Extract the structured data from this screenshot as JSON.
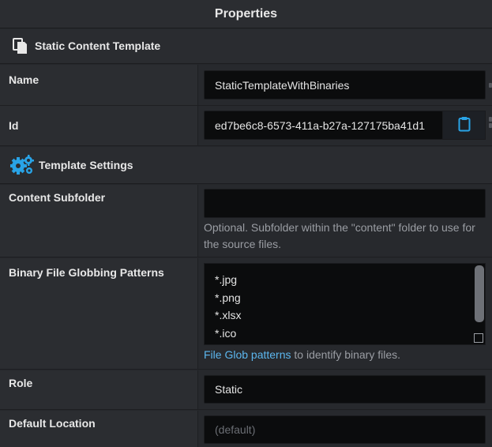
{
  "panel_title": "Properties",
  "sections": {
    "static": {
      "title": "Static Content Template",
      "icon": "copy-document-icon"
    },
    "settings": {
      "title": "Template Settings",
      "icon": "gears-icon"
    }
  },
  "fields": {
    "name": {
      "label": "Name",
      "value": "StaticTemplateWithBinaries"
    },
    "id": {
      "label": "Id",
      "value": "ed7be6c8-6573-411a-b27a-127175ba41d1",
      "action_icon": "clipboard-icon"
    },
    "content_subfolder": {
      "label": "Content Subfolder",
      "value": "",
      "help_line1": "Optional. Subfolder within the \"content\" folder to use for",
      "help_line2": "the source files."
    },
    "binary_patterns": {
      "label": "Binary File Globbing Patterns",
      "lines": [
        "*.jpg",
        "*.png",
        "*.xlsx",
        "*.ico"
      ],
      "help_link": "File Glob patterns",
      "help_rest": " to identify binary files."
    },
    "role": {
      "label": "Role",
      "value": "Static"
    },
    "default_location": {
      "label": "Default Location",
      "placeholder": "(default)"
    }
  },
  "colors": {
    "accent": "#29a3e6",
    "link": "#5cb7ef",
    "background": "#25272b"
  }
}
